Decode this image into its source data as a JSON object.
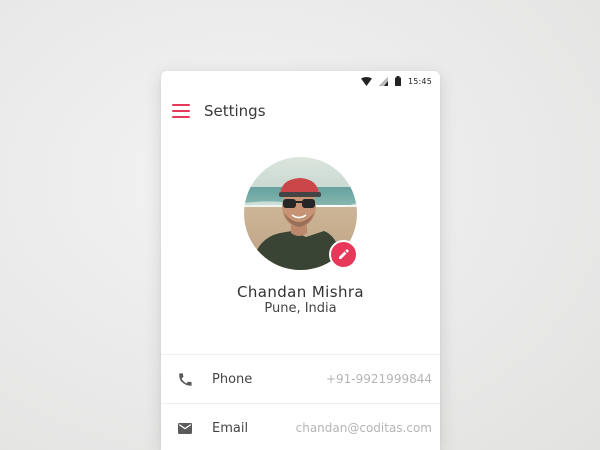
{
  "status_bar": {
    "time": "15:45",
    "icons": [
      "wifi-icon",
      "signal-icon",
      "battery-icon"
    ]
  },
  "app_bar": {
    "menu_icon": "hamburger-menu-icon",
    "title": "Settings"
  },
  "profile": {
    "name": "Chandan Mishra",
    "location": "Pune, India",
    "edit_icon": "pencil-icon"
  },
  "settings_list": [
    {
      "icon": "phone-icon",
      "label": "Phone",
      "value": "+91-9921999844"
    },
    {
      "icon": "mail-icon",
      "label": "Email",
      "value": "chandan@coditas.com"
    }
  ],
  "colors": {
    "accent": "#e8385a",
    "background": "#ececec",
    "card": "#ffffff",
    "value_text": "#b5b5b5"
  }
}
